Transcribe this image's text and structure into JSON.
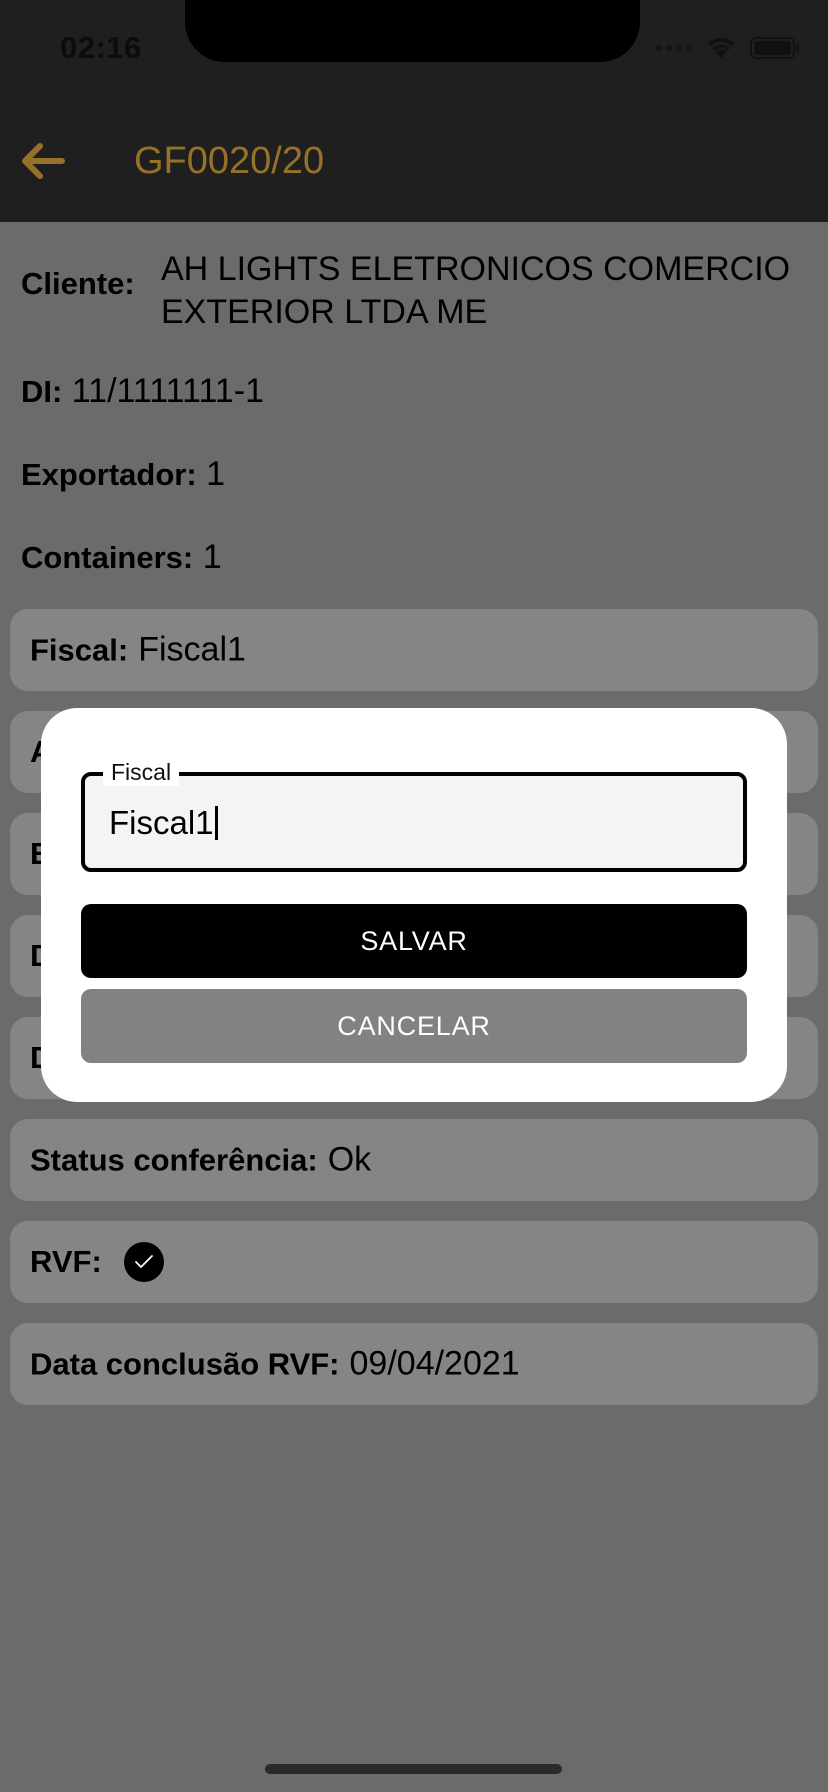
{
  "status_bar": {
    "time": "02:16"
  },
  "header": {
    "title": "GF0020/20",
    "back_icon": "arrow-left-icon"
  },
  "details": {
    "cliente": {
      "label": "Cliente:",
      "value_line1": "AH LIGHTS ELETRONICOS COMERCIO",
      "value_line2": "EXTERIOR LTDA ME"
    },
    "di": {
      "label": "DI:",
      "value": "11/1111111-1"
    },
    "exportador": {
      "label": "Exportador:",
      "value": "1"
    },
    "containers": {
      "label": "Containers:",
      "value": "1"
    }
  },
  "cards": {
    "fiscal": {
      "label": "Fiscal:",
      "value": "Fiscal1"
    },
    "hidden1": {
      "visible_char": "A"
    },
    "hidden2": {
      "visible_char": "E"
    },
    "hidden3": {
      "visible_char": "D"
    },
    "hidden4": {
      "visible_char": "D"
    },
    "status": {
      "label": "Status conferência:",
      "value": "Ok"
    },
    "rvf": {
      "label": "RVF:",
      "checked": true
    },
    "data_rvf": {
      "label": "Data conclusão RVF:",
      "value": "09/04/2021"
    }
  },
  "modal": {
    "field_label": "Fiscal",
    "field_value": "Fiscal1",
    "save_label": "SALVAR",
    "cancel_label": "CANCELAR"
  },
  "colors": {
    "header_bg": "#1f1f1f",
    "accent": "#96712a",
    "overlay_bg": "#6b6b6b",
    "card_bg": "#858585",
    "save_bg": "#000000",
    "cancel_bg": "#828282"
  }
}
